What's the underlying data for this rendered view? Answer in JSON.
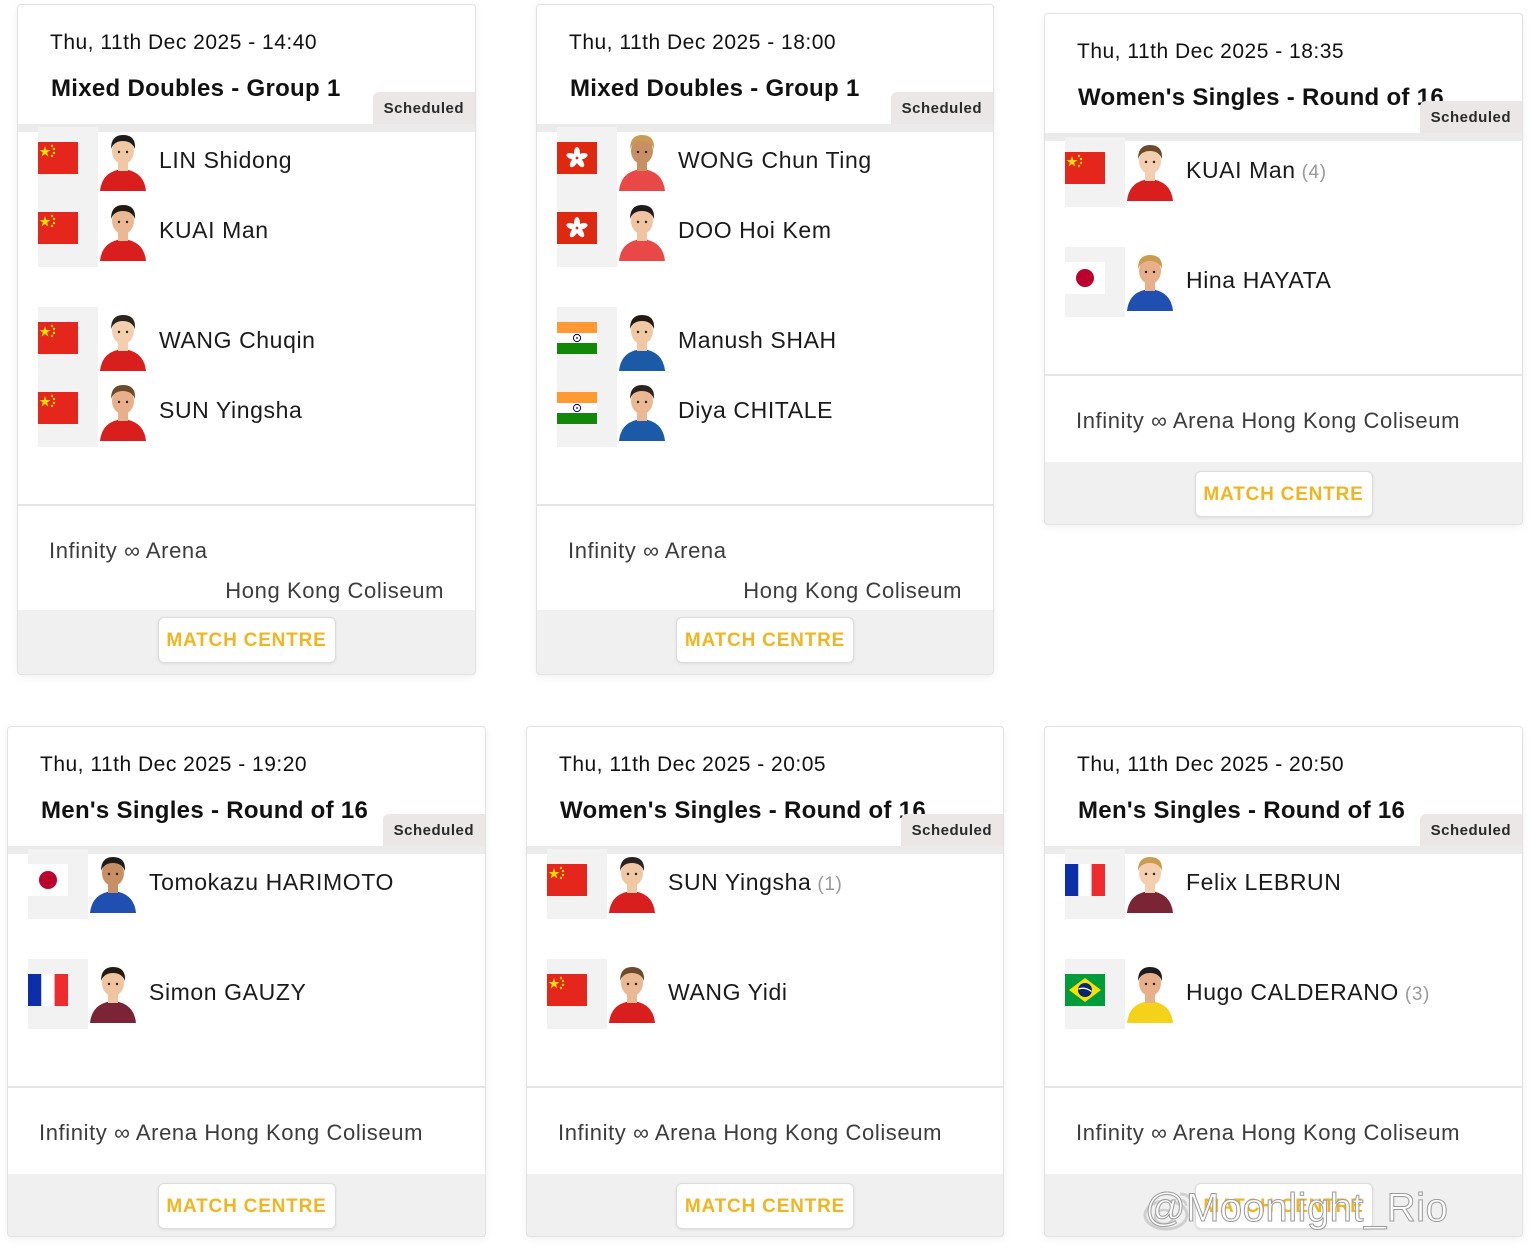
{
  "cards": [
    {
      "datetime": "Thu, 11th Dec 2025 - 14:40",
      "event": "Mixed Doubles - Group 1",
      "status": "Scheduled",
      "players": [
        {
          "name": "LIN Shidong",
          "seed": "",
          "country": "CHN"
        },
        {
          "name": "KUAI Man",
          "seed": "",
          "country": "CHN"
        },
        {
          "name": "WANG Chuqin",
          "seed": "",
          "country": "CHN"
        },
        {
          "name": "SUN Yingsha",
          "seed": "",
          "country": "CHN"
        }
      ],
      "venue": "Infinity ∞ Arena",
      "hall": "Hong Kong Coliseum",
      "button": "MATCH CENTRE"
    },
    {
      "datetime": "Thu, 11th Dec 2025 - 18:00",
      "event": "Mixed Doubles - Group 1",
      "status": "Scheduled",
      "players": [
        {
          "name": "WONG Chun Ting",
          "seed": "",
          "country": "HKG"
        },
        {
          "name": "DOO Hoi Kem",
          "seed": "",
          "country": "HKG"
        },
        {
          "name": "Manush SHAH",
          "seed": "",
          "country": "IND"
        },
        {
          "name": "Diya CHITALE",
          "seed": "",
          "country": "IND"
        }
      ],
      "venue": "Infinity ∞ Arena",
      "hall": "Hong Kong Coliseum",
      "button": "MATCH CENTRE"
    },
    {
      "datetime": "Thu, 11th Dec 2025 - 18:35",
      "event": "Women's Singles - Round of 16",
      "status": "Scheduled",
      "players": [
        {
          "name": "KUAI Man",
          "seed": "(4)",
          "country": "CHN"
        },
        {
          "name": "Hina HAYATA",
          "seed": "",
          "country": "JPN"
        }
      ],
      "venue": "Infinity ∞ Arena",
      "hall": "Hong Kong Coliseum",
      "button": "MATCH CENTRE"
    },
    {
      "datetime": "Thu, 11th Dec 2025 - 19:20",
      "event": "Men's Singles - Round of 16",
      "status": "Scheduled",
      "players": [
        {
          "name": "Tomokazu HARIMOTO",
          "seed": "",
          "country": "JPN"
        },
        {
          "name": "Simon GAUZY",
          "seed": "",
          "country": "FRA"
        }
      ],
      "venue": "Infinity ∞ Arena",
      "hall": "Hong Kong Coliseum",
      "button": "MATCH CENTRE"
    },
    {
      "datetime": "Thu, 11th Dec 2025 - 20:05",
      "event": "Women's Singles - Round of 16",
      "status": "Scheduled",
      "players": [
        {
          "name": "SUN Yingsha",
          "seed": "(1)",
          "country": "CHN"
        },
        {
          "name": "WANG Yidi",
          "seed": "",
          "country": "CHN"
        }
      ],
      "venue": "Infinity ∞ Arena",
      "hall": "Hong Kong Coliseum",
      "button": "MATCH CENTRE"
    },
    {
      "datetime": "Thu, 11th Dec 2025 - 20:50",
      "event": "Men's Singles - Round of 16",
      "status": "Scheduled",
      "players": [
        {
          "name": "Felix LEBRUN",
          "seed": "",
          "country": "FRA"
        },
        {
          "name": "Hugo CALDERANO",
          "seed": "(3)",
          "country": "BRA"
        }
      ],
      "venue": "Infinity ∞ Arena",
      "hall": "Hong Kong Coliseum",
      "button": "MATCH CENTRE"
    }
  ],
  "watermark": "@Moonlight_Rio",
  "colors": {
    "accent": "#f2b522",
    "badge_bg": "#ebe7e7",
    "footer_bg": "#f0f0f0"
  }
}
